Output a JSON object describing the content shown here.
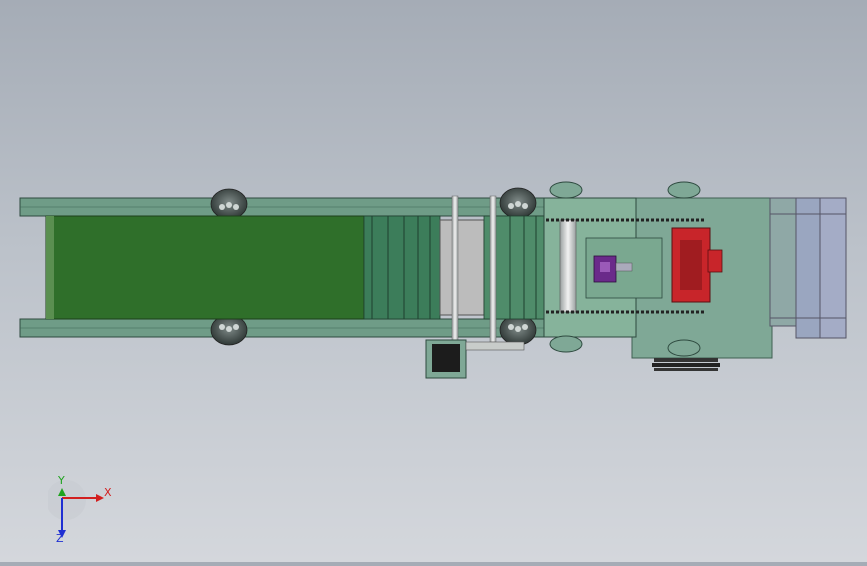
{
  "viewport": {
    "background_top": "#a5acb6",
    "background_bottom": "#d4d7dc"
  },
  "model": {
    "frame_color": "#6f9c87",
    "belt_color": "#2f6f2a",
    "motor_color": "#c8252a",
    "bracket_color": "#6a2a8a",
    "cover_color": "#bcbcbc",
    "wheel_color": "#4e5a58"
  },
  "triad": {
    "x_label": "X",
    "y_label": "Y",
    "z_label": "Z",
    "x_color": "#d21f1f",
    "y_color": "#1fa31f",
    "z_color": "#1f2fd2"
  }
}
